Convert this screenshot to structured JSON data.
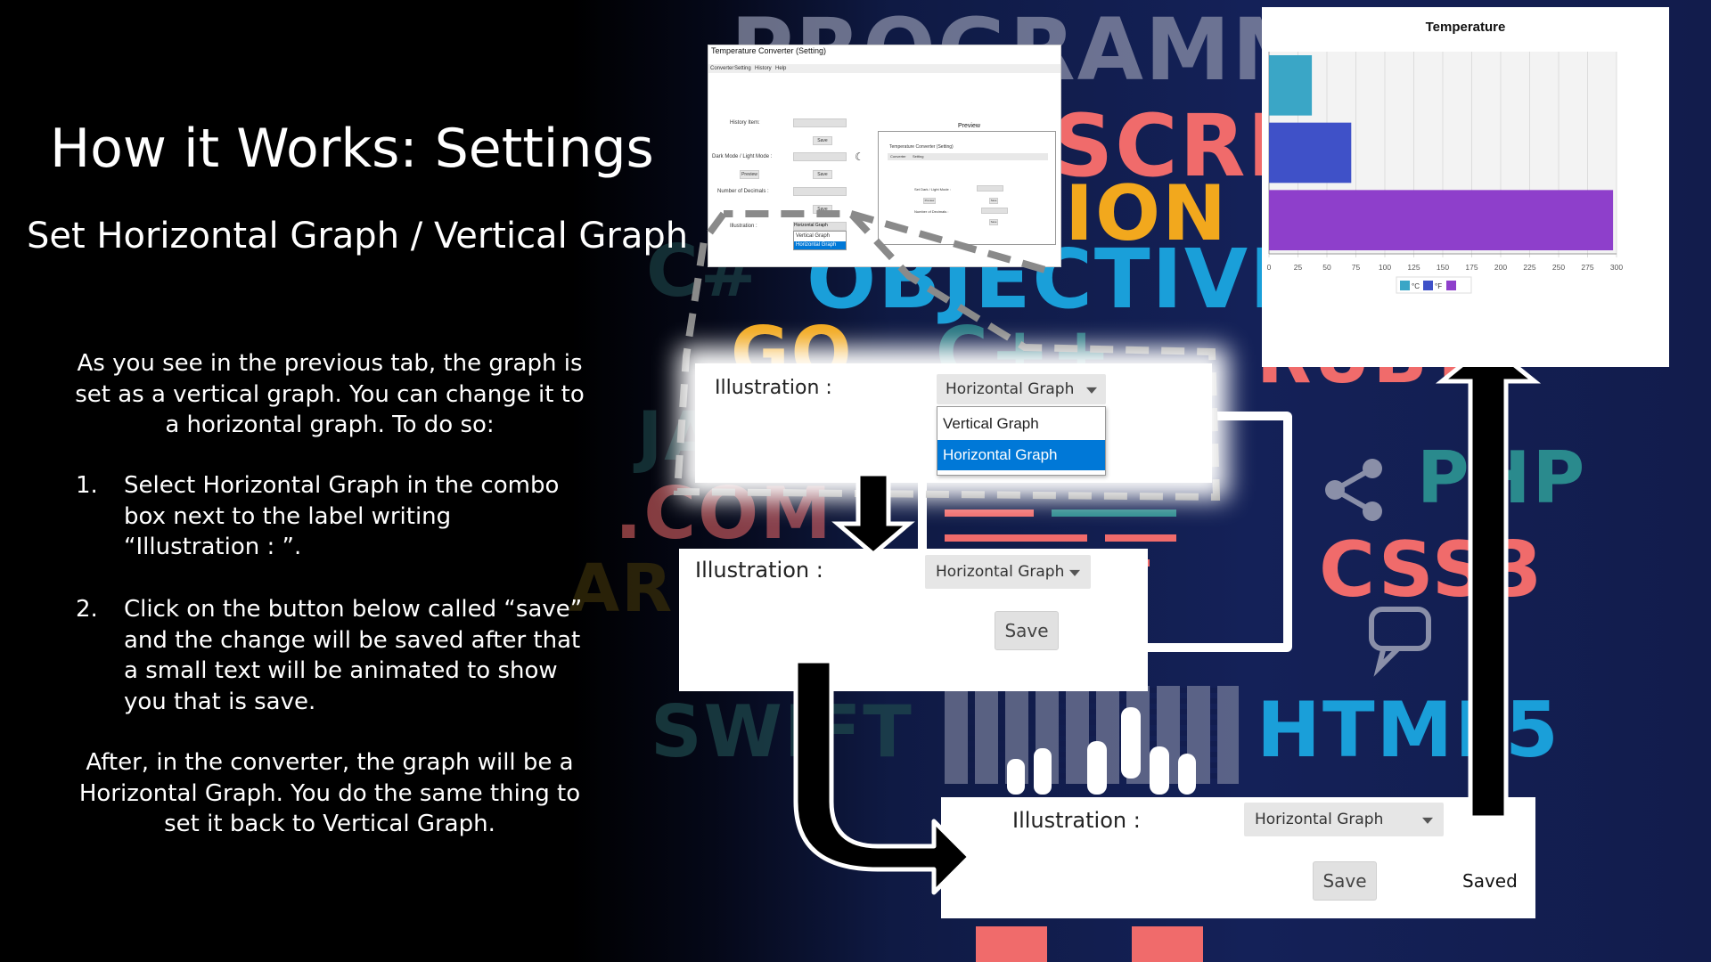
{
  "slide": {
    "title": "How it Works: Settings",
    "subtitle": "Set Horizontal Graph / Vertical Graph",
    "intro": [
      "As you see in the previous tab, the graph is",
      "set as a vertical graph. You can change it to",
      "a horizontal graph. To do so:"
    ],
    "steps": [
      {
        "num": "1.",
        "lines": [
          "Select Horizontal Graph in the combo",
          "box next to the label writing",
          "“Illustration : ”."
        ]
      },
      {
        "num": "2.",
        "lines": [
          "Click on the button below called “save”",
          "and the change will be saved after that",
          "a small text will be animated to show",
          "you that is save."
        ]
      }
    ],
    "outro": [
      "After, in the converter, the graph will be a",
      "Horizontal Graph. You do the same thing to",
      "set it back to Vertical Graph."
    ]
  },
  "background_words": [
    "PROGRAMM",
    "SCRIP",
    "ION",
    "OBJECTIVE",
    "GO",
    "C++",
    "C#",
    "RUBY",
    "PHP",
    "CSS3",
    "HTML5",
    "SWIFT",
    ".COM",
    "ARD",
    "JA"
  ],
  "mini_screenshot": {
    "window_title": "Temperature Converter (Setting)",
    "menu": [
      "Converter",
      "Setting",
      "History",
      "Help"
    ],
    "history_label": "History Item:",
    "mode_label": "Dark Mode / Light Mode :",
    "decimals_label": "Number of Decimals :",
    "illustration_label": "Illustration :",
    "save": "Save",
    "preview": "Preview",
    "preview_title": "Preview",
    "combo_value": "Horizontal Graph",
    "options": [
      "Vertical Graph",
      "Horizontal Graph"
    ],
    "preview_window_title": "Temperature Converter (Setting)",
    "preview_menu": [
      "Converter",
      "Setting"
    ],
    "preview_labels": [
      "Set Dark / Light Mode :",
      "Number of Decimals :"
    ],
    "preview_buttons": [
      "Preview",
      "Save"
    ]
  },
  "dropdown_panel": {
    "label": "Illustration :",
    "combo_value": "Horizontal Graph",
    "options": [
      "Vertical Graph",
      "Horizontal Graph"
    ],
    "selected_index": 1
  },
  "save_panel": {
    "label": "Illustration :",
    "combo_value": "Horizontal Graph",
    "save_button": "Save"
  },
  "saved_panel": {
    "label": "Illustration :",
    "combo_value": "Horizontal Graph",
    "save_button": "Save",
    "saved_text": "Saved"
  },
  "chart_data": {
    "type": "bar",
    "orientation": "horizontal",
    "title": "Temperature",
    "xlabel": "",
    "ylabel": "",
    "xlim": [
      0,
      300
    ],
    "ticks": [
      "0",
      "25",
      "50",
      "75",
      "100",
      "125",
      "150",
      "175",
      "200",
      "225",
      "250",
      "275",
      "300"
    ],
    "series": [
      {
        "name": "°C",
        "value": 37,
        "color": "#3aa6c6"
      },
      {
        "name": "°F",
        "value": 71,
        "color": "#3f51c8"
      },
      {
        "name": "",
        "value": 297,
        "color": "#8e3fcb"
      }
    ],
    "legend_position": "bottom",
    "grid": true
  },
  "colors": {
    "selected_option_bg": "#0078d7",
    "combo_bg": "#e6e6e6",
    "arrow": "#000000"
  }
}
